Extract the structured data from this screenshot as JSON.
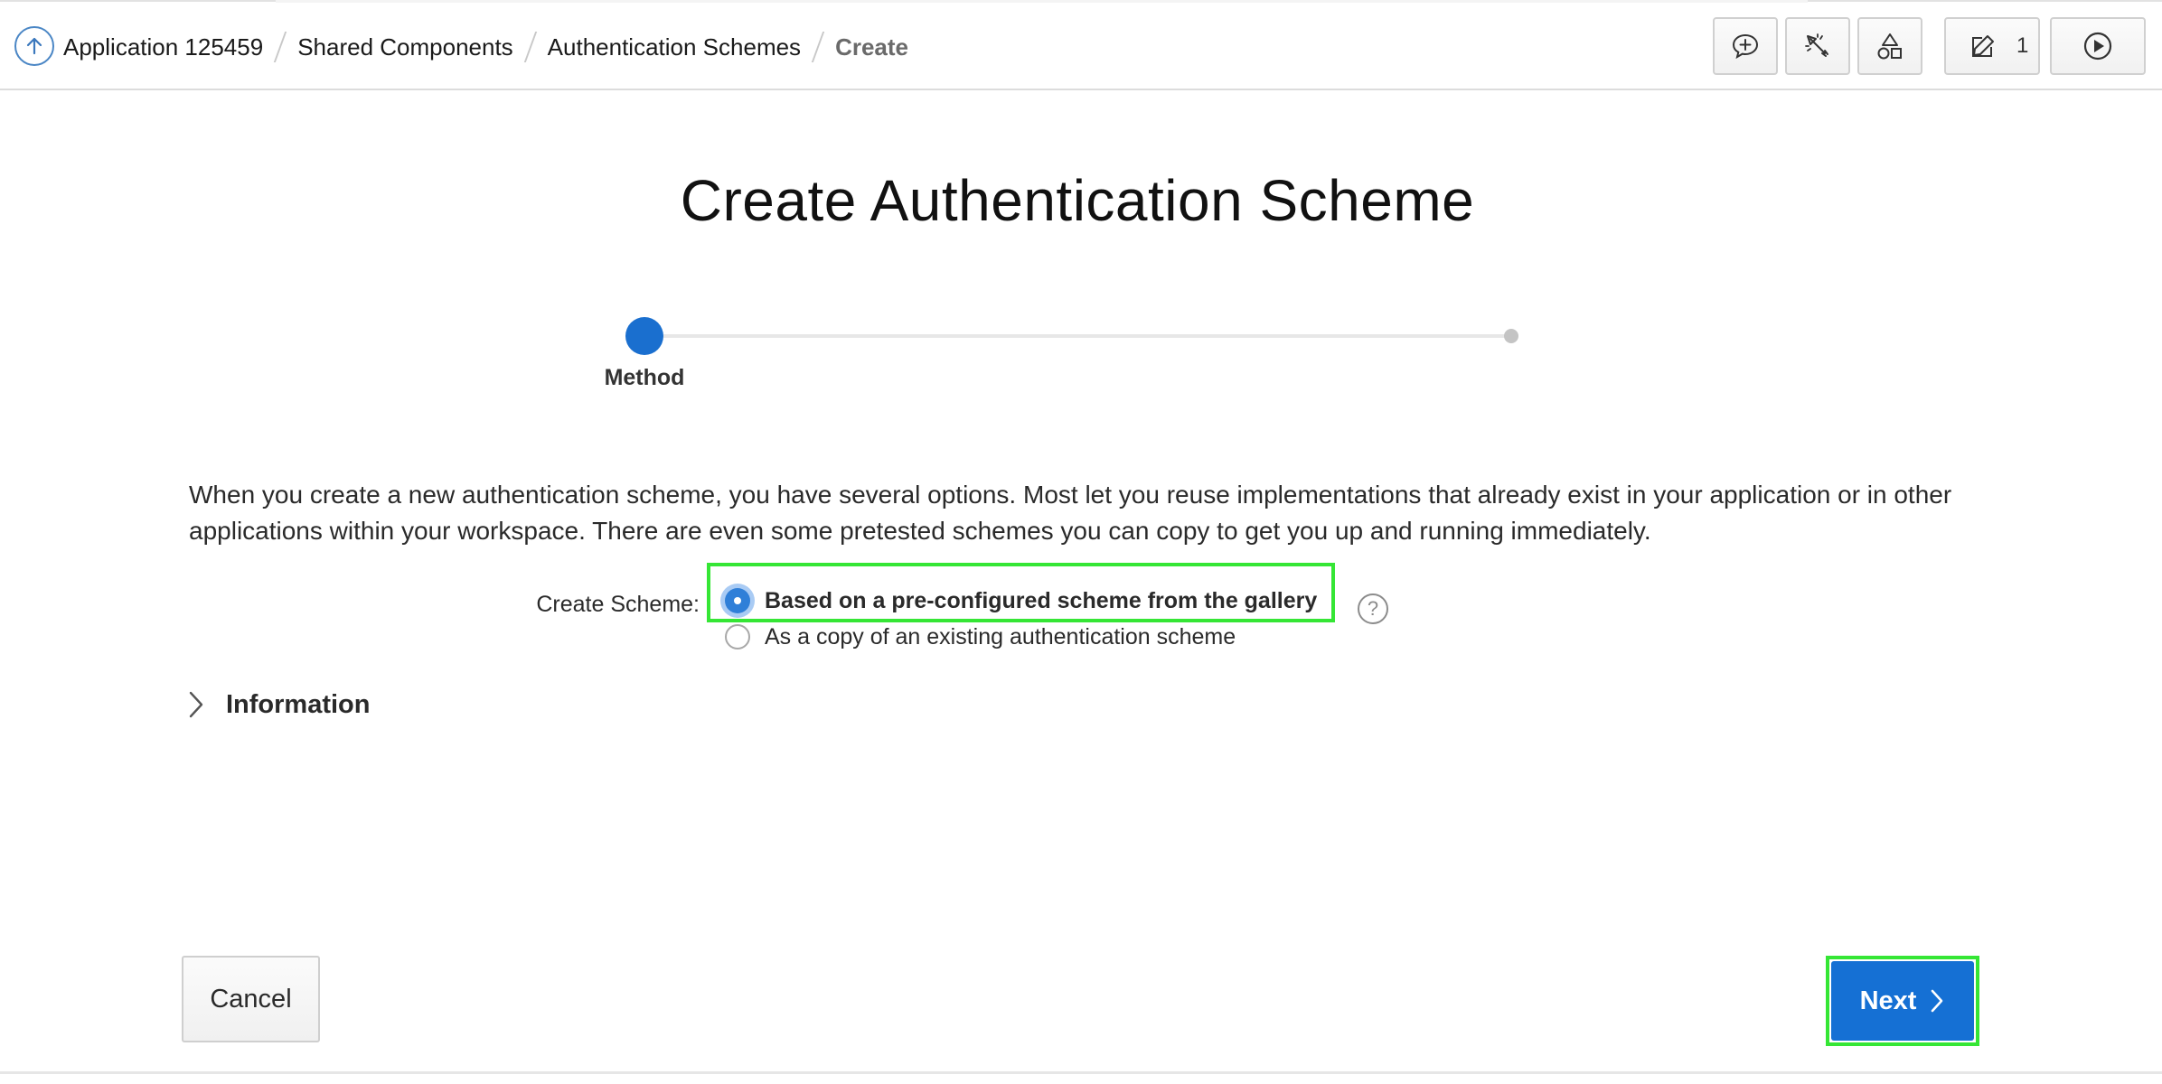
{
  "breadcrumb": {
    "items": [
      "Application 125459",
      "Shared Components",
      "Authentication Schemes"
    ],
    "current": "Create"
  },
  "toolbar": {
    "edit_count": "1",
    "icons": [
      "comment-add-icon",
      "spotlight-icon",
      "shapes-icon",
      "edit-icon",
      "run-icon"
    ]
  },
  "page": {
    "title": "Create Authentication Scheme"
  },
  "wizard": {
    "current_step_label": "Method",
    "steps_total": 2,
    "current_step": 1
  },
  "intro_text": "When you create a new authentication scheme, you have several options. Most let you reuse implementations that already exist in your application or in other applications within your workspace. There are even some pretested schemes you can copy to get you up and running immediately.",
  "form": {
    "create_scheme_label": "Create Scheme:",
    "options": [
      {
        "label": "Based on a pre-configured scheme from the gallery",
        "selected": true
      },
      {
        "label": "As a copy of an existing authentication scheme",
        "selected": false
      }
    ],
    "help_glyph": "?"
  },
  "info_section": {
    "label": "Information",
    "expanded": false
  },
  "buttons": {
    "cancel": "Cancel",
    "next": "Next"
  },
  "colors": {
    "accent": "#1570d4",
    "highlight": "#35e635"
  }
}
